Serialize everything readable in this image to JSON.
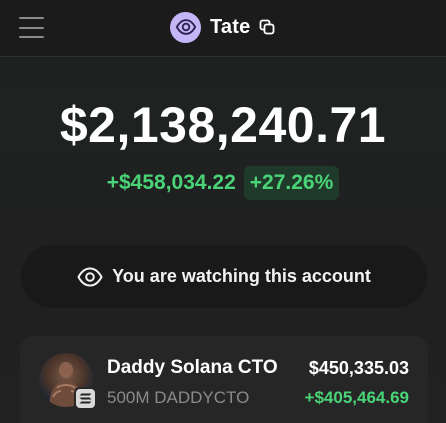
{
  "header": {
    "menu_icon": "hamburger-menu-icon",
    "account_icon": "eye-icon",
    "account_name": "Tate",
    "copy_icon": "copy-icon",
    "accent_color": "#c3b5f6"
  },
  "portfolio": {
    "balance": "$2,138,240.71",
    "change_amount": "+$458,034.22",
    "change_percent": "+27.26%",
    "positive_color": "#4ad477"
  },
  "watch_banner": {
    "icon": "eye-icon",
    "text": "You are watching this account"
  },
  "holdings": [
    {
      "name": "Daddy Solana CTO",
      "amount": "500M DADDYCTO",
      "value": "$450,335.03",
      "pnl": "+$405,464.69",
      "chain_icon": "solana-icon"
    }
  ]
}
